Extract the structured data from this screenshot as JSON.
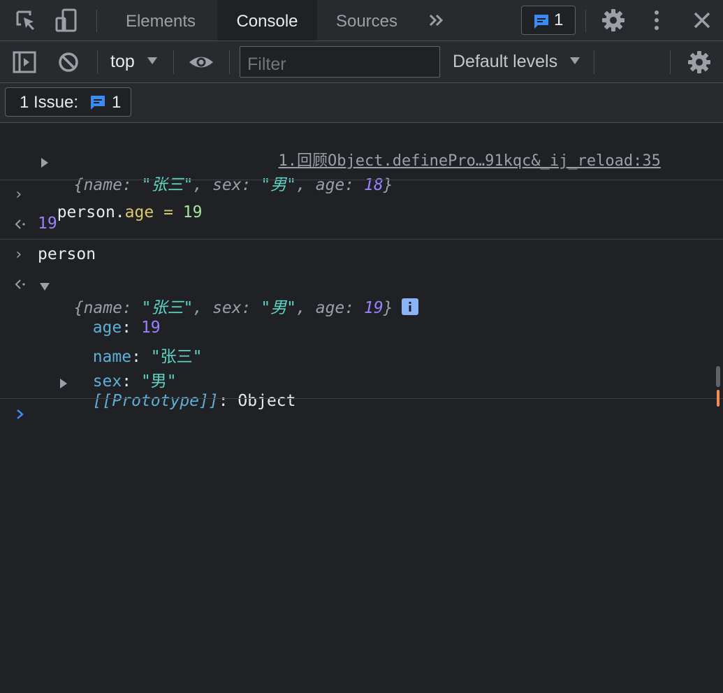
{
  "tabs": [
    {
      "label": "Elements",
      "active": false
    },
    {
      "label": "Console",
      "active": true
    },
    {
      "label": "Sources",
      "active": false
    }
  ],
  "tabbar": {
    "issues_count": "1"
  },
  "toolbar": {
    "context": "top",
    "filter_placeholder": "Filter",
    "levels": "Default levels"
  },
  "issues": {
    "label": "1 Issue:",
    "count": "1"
  },
  "console": {
    "source_link": "1.回顾Object.definePro…91kqc&_ij_reload:35",
    "log_object": {
      "open": "{",
      "k_name": "name",
      "v_name": "\"张三\"",
      "k_sex": "sex",
      "v_sex": "\"男\"",
      "k_age": "age",
      "v_age": "18",
      "close": "}"
    },
    "input1": {
      "obj": "person",
      "prop": "age",
      "op": "=",
      "val": "19"
    },
    "result1": "19",
    "input2": "person",
    "result2": {
      "k_name": "name",
      "v_name": "\"张三\"",
      "k_sex": "sex",
      "v_sex": "\"男\"",
      "k_age": "age",
      "v_age": "19"
    },
    "props": [
      {
        "key": "age",
        "value": "19"
      },
      {
        "key": "name",
        "value": "\"张三\""
      },
      {
        "key": "sex",
        "value": "\"男\""
      }
    ],
    "prototype": {
      "key": "[[Prototype]]",
      "value": "Object"
    }
  },
  "colors": {
    "background": "#202124",
    "toolbar": "#292a2d",
    "accent": "#8ab4f8",
    "string": "#5cd5c6",
    "number": "#9980ff",
    "property": "#5db0d7"
  }
}
